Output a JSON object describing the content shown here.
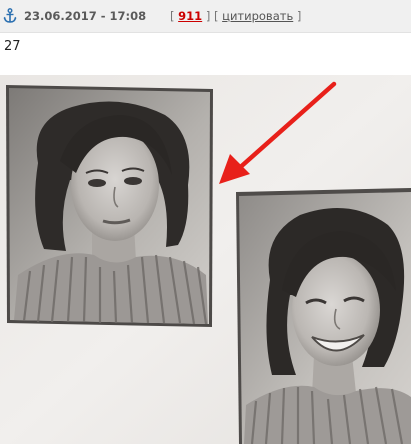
{
  "post": {
    "date": "23.06.2017 - 17:08",
    "bracket_open": "[",
    "number": "911",
    "separator": "] [",
    "quote_label": "цитировать",
    "bracket_close": "]",
    "body_text": "27"
  },
  "icons": {
    "anchor": "anchor-icon"
  },
  "colors": {
    "header_bg": "#f0f0f0",
    "anchor": "#2a6fb0",
    "post_number": "#cc0000",
    "arrow": "#e8201a"
  },
  "image": {
    "content": "two vintage black-and-white portrait photographs of a young woman on a page, red arrow pointing to the upper photo"
  }
}
